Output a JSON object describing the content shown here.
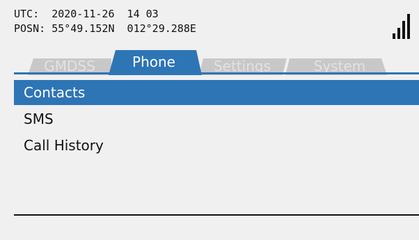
{
  "status": {
    "utc_label": "UTC:",
    "utc_value": "2020-11-26  14 03",
    "posn_label": "POSN:",
    "posn_value": "55°49.152N  012°29.288E",
    "signal_icon": "signal-strength-icon"
  },
  "tabs": [
    {
      "label": "GMDSS",
      "active": false
    },
    {
      "label": "Phone",
      "active": true
    },
    {
      "label": "Settings",
      "active": false
    },
    {
      "label": "System",
      "active": false
    }
  ],
  "menu": {
    "items": [
      {
        "label": "Contacts",
        "selected": true
      },
      {
        "label": "SMS",
        "selected": false
      },
      {
        "label": "Call History",
        "selected": false
      }
    ]
  },
  "colors": {
    "background": "#f0f0f0",
    "accent": "#2e75b6",
    "inactive_tab": "#c8c8c8",
    "inactive_tab_text": "#e2e2e2"
  }
}
